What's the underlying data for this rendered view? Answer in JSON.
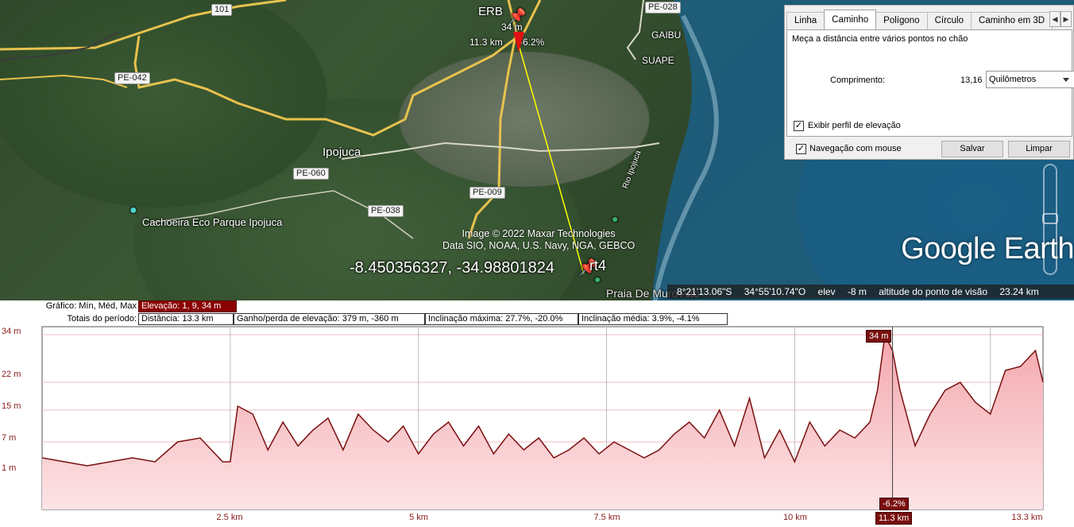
{
  "map": {
    "labels": {
      "erb": "ERB",
      "marker_elev": "34 m",
      "marker_dist": "11.3 km",
      "marker_slope": "-6.2%",
      "gaibu": "GAIBU",
      "suape": "SUAPE",
      "ipojuca": "Ipojuca",
      "cachoeira": "Cachoeira Eco Parque Ipojuca",
      "praia": "Praia De Muro Alto",
      "rio": "Rio Ipojuca",
      "pt": "rt4"
    },
    "roads": {
      "r101": "101",
      "pe028": "PE-028",
      "pe042": "PE-042",
      "pe060": "PE-060",
      "pe038": "PE-038",
      "pe009": "PE-009"
    },
    "coordinates_overlay": "-8.450356327, -34.98801824",
    "attribution_line1": "Image © 2022 Maxar Technologies",
    "attribution_line2": "Data SIO, NOAA, U.S. Navy, NGA, GEBCO",
    "logo": "Google Earth"
  },
  "statusbar": {
    "lat": "8°21'13.06\"S",
    "lon": "34°55'10.74\"O",
    "elev_label": "elev",
    "elev_value": "-8 m",
    "eye_label": "altitude do ponto de visão",
    "eye_value": "23.24 km"
  },
  "ruler": {
    "tabs": [
      "Linha",
      "Caminho",
      "Polígono",
      "Círculo",
      "Caminho em 3D"
    ],
    "active_tab": "Caminho",
    "description": "Meça a distância entre vários pontos no chão",
    "length_label": "Comprimento:",
    "length_value": "13,16",
    "unit": "Quilômetros",
    "show_profile_label": "Exibir perfil de elevação",
    "show_profile_checked": true,
    "mouse_nav_label": "Navegação com mouse",
    "mouse_nav_checked": true,
    "save_label": "Salvar",
    "clear_label": "Limpar"
  },
  "profile": {
    "graph_label": "Gráfico: Mín, Méd, Max",
    "elevation_stat": "Elevação: 1, 9, 34 m",
    "totals_label": "Totais do período:",
    "distance_stat": "Distância: 13.3 km",
    "gain_stat": "Ganho/perda de elevação: 379 m, -360 m",
    "max_slope_stat": "Inclinação máxima: 27.7%, -20.0%",
    "avg_slope_stat": "Inclinação média: 3.9%, -4.1%",
    "cursor_elev": "34 m",
    "cursor_slope": "-6.2%",
    "cursor_dist": "11.3 km",
    "y_ticks": [
      "34 m",
      "22 m",
      "15 m",
      "7 m",
      "1 m"
    ],
    "x_ticks": [
      "2.5 km",
      "5 km",
      "7.5 km",
      "10 km",
      "13.3 km"
    ]
  },
  "chart_data": {
    "type": "area",
    "xlabel": "",
    "ylabel": "",
    "ylim": [
      -10,
      36
    ],
    "xlim": [
      0,
      13.3
    ],
    "x_ticks": [
      "2.5 km",
      "5 km",
      "7.5 km",
      "10 km",
      "13.3 km"
    ],
    "y_ticks": [
      "34 m",
      "22 m",
      "15 m",
      "7 m",
      "1 m"
    ],
    "series": [
      {
        "color": "#7a0f0f",
        "x": [
          0,
          0.3,
          0.6,
          0.9,
          1.2,
          1.5,
          1.8,
          2.1,
          2.4,
          2.5,
          2.6,
          2.8,
          3.0,
          3.2,
          3.4,
          3.6,
          3.8,
          4.0,
          4.2,
          4.4,
          4.6,
          4.8,
          5.0,
          5.2,
          5.4,
          5.6,
          5.8,
          6.0,
          6.2,
          6.4,
          6.6,
          6.8,
          7.0,
          7.2,
          7.4,
          7.6,
          7.8,
          8.0,
          8.2,
          8.4,
          8.6,
          8.8,
          9.0,
          9.2,
          9.4,
          9.6,
          9.8,
          10.0,
          10.2,
          10.4,
          10.6,
          10.8,
          11.0,
          11.1,
          11.2,
          11.3,
          11.4,
          11.6,
          11.8,
          12.0,
          12.2,
          12.4,
          12.6,
          12.8,
          13.0,
          13.2,
          13.3
        ],
        "y": [
          3,
          2,
          1,
          2,
          3,
          2,
          7,
          8,
          2,
          2,
          16,
          14,
          5,
          12,
          6,
          10,
          13,
          5,
          14,
          10,
          7,
          11,
          4,
          9,
          12,
          6,
          11,
          4,
          9,
          5,
          8,
          3,
          5,
          8,
          4,
          7,
          5,
          3,
          5,
          9,
          12,
          8,
          15,
          6,
          18,
          3,
          10,
          2,
          12,
          6,
          10,
          8,
          12,
          20,
          34,
          30,
          20,
          6,
          14,
          20,
          22,
          17,
          14,
          25,
          26,
          30,
          22
        ]
      }
    ]
  }
}
